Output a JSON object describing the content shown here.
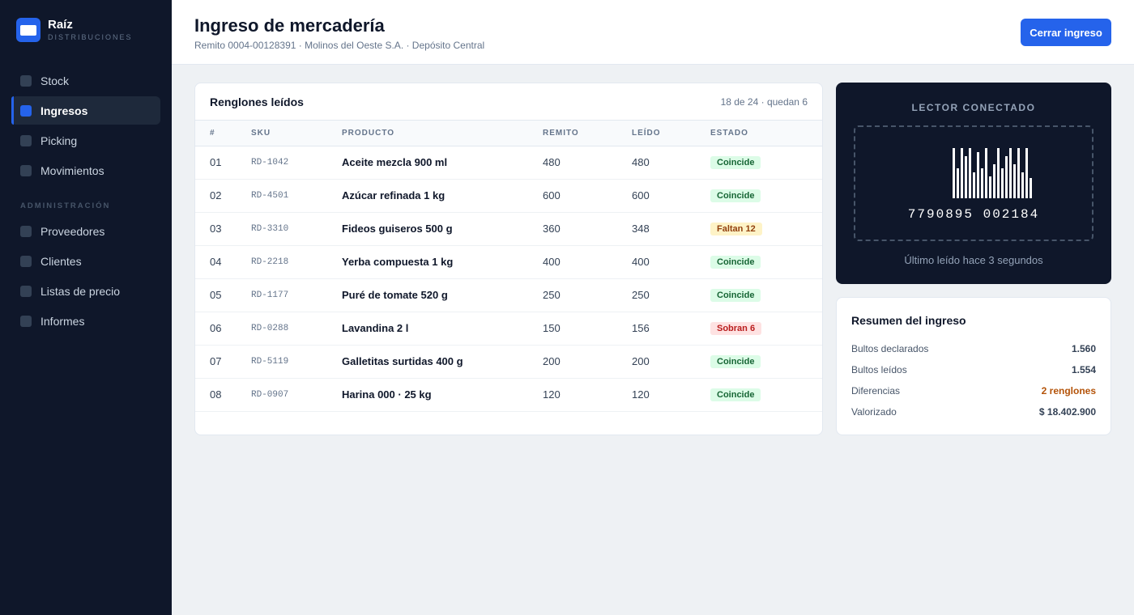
{
  "brand": {
    "name": "Raíz",
    "sub": "DISTRIBUCIONES"
  },
  "sidebar": {
    "items": [
      {
        "label": "Stock",
        "active": false
      },
      {
        "label": "Ingresos",
        "active": true
      },
      {
        "label": "Picking",
        "active": false
      },
      {
        "label": "Movimientos",
        "active": false
      }
    ],
    "section_label": "ADMINISTRACIÓN",
    "admin_items": [
      {
        "label": "Proveedores"
      },
      {
        "label": "Clientes"
      },
      {
        "label": "Listas de precio"
      },
      {
        "label": "Informes"
      }
    ]
  },
  "header": {
    "title": "Ingreso de mercadería",
    "subtitle": "Remito 0004-00128391 · Molinos del Oeste S.A. · Depósito Central",
    "close_button": "Cerrar ingreso"
  },
  "table": {
    "title": "Renglones leídos",
    "meta": "18 de 24 · quedan 6",
    "columns": [
      "#",
      "SKU",
      "PRODUCTO",
      "REMITO",
      "LEÍDO",
      "ESTADO"
    ],
    "rows": [
      {
        "num": "01",
        "sku": "RD-1042",
        "product": "Aceite mezcla 900 ml",
        "remito": "480",
        "leido": "480",
        "status": "Coincide",
        "status_type": "ok"
      },
      {
        "num": "02",
        "sku": "RD-4501",
        "product": "Azúcar refinada 1 kg",
        "remito": "600",
        "leido": "600",
        "status": "Coincide",
        "status_type": "ok"
      },
      {
        "num": "03",
        "sku": "RD-3310",
        "product": "Fideos guiseros 500 g",
        "remito": "360",
        "leido": "348",
        "status": "Faltan 12",
        "status_type": "warn"
      },
      {
        "num": "04",
        "sku": "RD-2218",
        "product": "Yerba compuesta 1 kg",
        "remito": "400",
        "leido": "400",
        "status": "Coincide",
        "status_type": "ok"
      },
      {
        "num": "05",
        "sku": "RD-1177",
        "product": "Puré de tomate 520 g",
        "remito": "250",
        "leido": "250",
        "status": "Coincide",
        "status_type": "ok"
      },
      {
        "num": "06",
        "sku": "RD-0288",
        "product": "Lavandina 2 l",
        "remito": "150",
        "leido": "156",
        "status": "Sobran 6",
        "status_type": "err"
      },
      {
        "num": "07",
        "sku": "RD-5119",
        "product": "Galletitas surtidas 400 g",
        "remito": "200",
        "leido": "200",
        "status": "Coincide",
        "status_type": "ok"
      },
      {
        "num": "08",
        "sku": "RD-0907",
        "product": "Harina 000 · 25 kg",
        "remito": "120",
        "leido": "120",
        "status": "Coincide",
        "status_type": "ok"
      }
    ]
  },
  "scanner": {
    "title": "LECTOR CONECTADO",
    "barcode_number": "7790895 002184",
    "footer": "Último leído hace 3 segundos"
  },
  "summary": {
    "title": "Resumen del ingreso",
    "rows": [
      {
        "label": "Bultos declarados",
        "value": "1.560",
        "accent": false
      },
      {
        "label": "Bultos leídos",
        "value": "1.554",
        "accent": false
      },
      {
        "label": "Diferencias",
        "value": "2 renglones",
        "accent": true
      },
      {
        "label": "Valorizado",
        "value": "$ 18.402.900",
        "accent": false
      }
    ]
  }
}
